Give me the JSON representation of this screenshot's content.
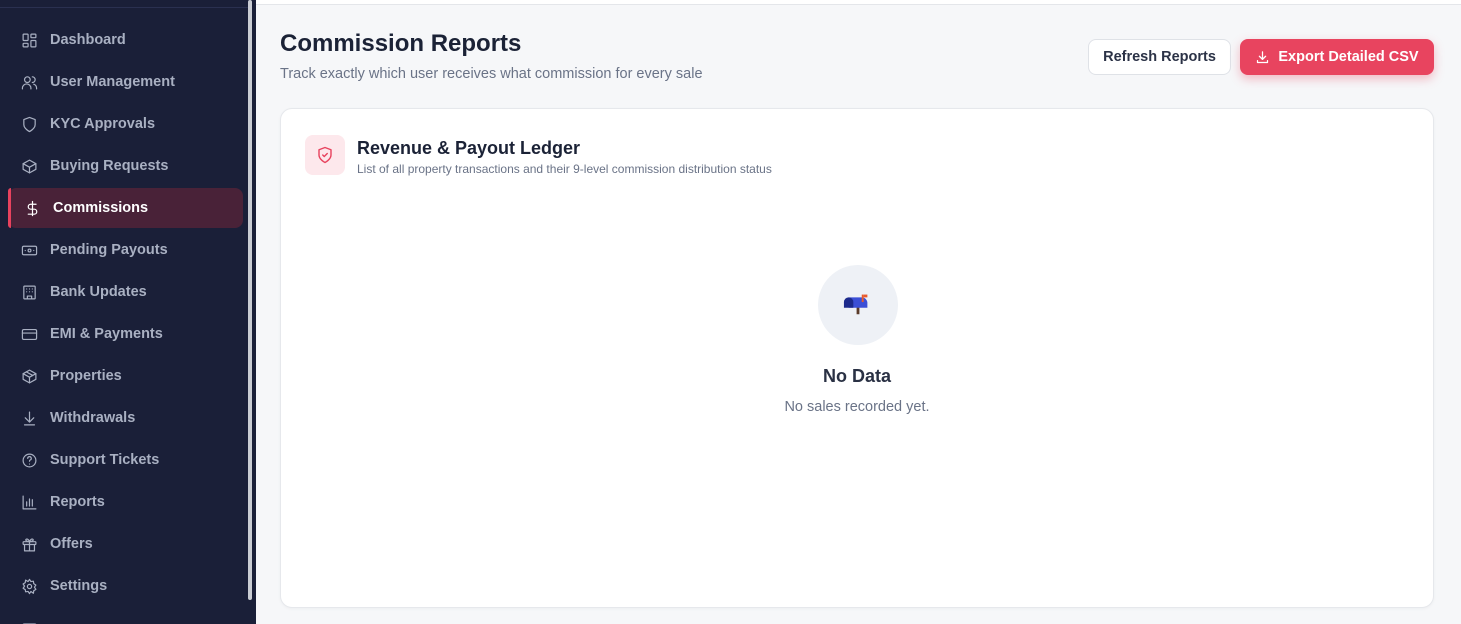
{
  "sidebar": {
    "items": [
      {
        "label": "Dashboard",
        "icon": "grid-icon"
      },
      {
        "label": "User Management",
        "icon": "users-icon"
      },
      {
        "label": "KYC Approvals",
        "icon": "shield-icon"
      },
      {
        "label": "Buying Requests",
        "icon": "box-icon"
      },
      {
        "label": "Commissions",
        "icon": "dollar-icon",
        "active": true
      },
      {
        "label": "Pending Payouts",
        "icon": "banknote-icon"
      },
      {
        "label": "Bank Updates",
        "icon": "building-icon"
      },
      {
        "label": "EMI & Payments",
        "icon": "credit-card-icon"
      },
      {
        "label": "Properties",
        "icon": "package-icon"
      },
      {
        "label": "Withdrawals",
        "icon": "download-arrow-icon"
      },
      {
        "label": "Support Tickets",
        "icon": "help-circle-icon"
      },
      {
        "label": "Reports",
        "icon": "bar-chart-icon"
      },
      {
        "label": "Offers",
        "icon": "gift-icon"
      },
      {
        "label": "Settings",
        "icon": "gear-icon"
      }
    ]
  },
  "header": {
    "title": "Commission Reports",
    "subtitle": "Track exactly which user receives what commission for every sale",
    "refresh_label": "Refresh Reports",
    "export_label": "Export Detailed CSV"
  },
  "ledger": {
    "title": "Revenue & Payout Ledger",
    "subtitle": "List of all property transactions and their 9-level commission distribution status",
    "empty_icon": "mailbox-icon",
    "empty_title": "No Data",
    "empty_message": "No sales recorded yet."
  },
  "colors": {
    "accent": "#e8445f",
    "sidebar_bg": "#1a1f38",
    "active_bg": "#492238"
  }
}
